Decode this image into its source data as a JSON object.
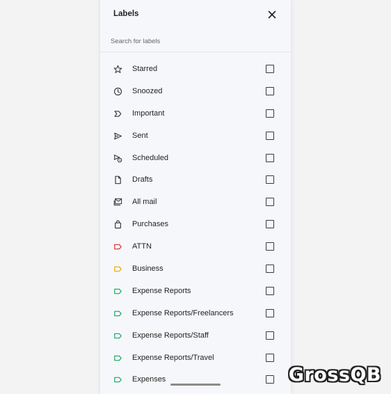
{
  "panel": {
    "title": "Labels",
    "search_placeholder": "Search for labels"
  },
  "labels": [
    {
      "label": "Starred",
      "icon": "star-icon",
      "color": "#3c3c3c"
    },
    {
      "label": "Snoozed",
      "icon": "clock-icon",
      "color": "#3c3c3c"
    },
    {
      "label": "Important",
      "icon": "important-icon",
      "color": "#3c3c3c"
    },
    {
      "label": "Sent",
      "icon": "send-icon",
      "color": "#3c3c3c"
    },
    {
      "label": "Scheduled",
      "icon": "scheduled-send-icon",
      "color": "#3c3c3c"
    },
    {
      "label": "Drafts",
      "icon": "draft-icon",
      "color": "#3c3c3c"
    },
    {
      "label": "All mail",
      "icon": "all-mail-icon",
      "color": "#3c3c3c"
    },
    {
      "label": "Purchases",
      "icon": "shopping-bag-icon",
      "color": "#3c3c3c"
    },
    {
      "label": "ATTN",
      "icon": "label-tag-icon",
      "color": "#d93025"
    },
    {
      "label": "Business",
      "icon": "label-tag-icon",
      "color": "#f2a600"
    },
    {
      "label": "Expense Reports",
      "icon": "label-tag-icon",
      "color": "#16a765"
    },
    {
      "label": "Expense Reports/Freelancers",
      "icon": "label-tag-icon",
      "color": "#16a765"
    },
    {
      "label": "Expense Reports/Staff",
      "icon": "label-tag-icon",
      "color": "#16a765"
    },
    {
      "label": "Expense Reports/Travel",
      "icon": "label-tag-icon",
      "color": "#16a765"
    },
    {
      "label": "Expenses",
      "icon": "label-tag-icon",
      "color": "#16a765"
    }
  ],
  "watermark": "GrossQB"
}
